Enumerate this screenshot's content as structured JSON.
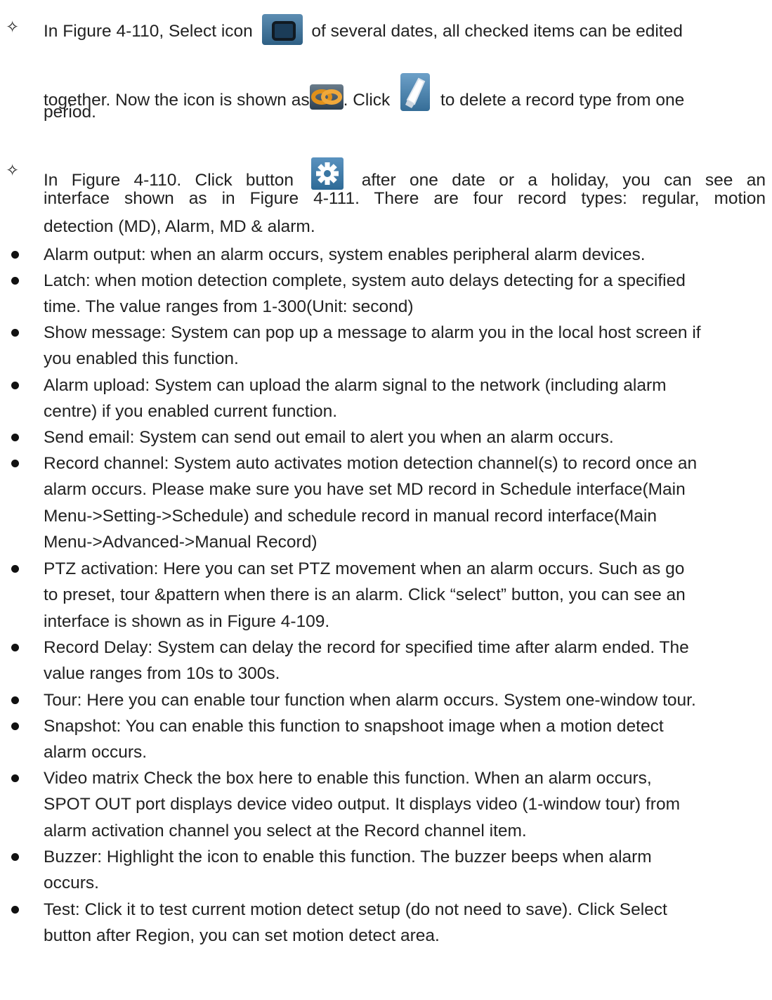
{
  "block1": {
    "line1_a": "In Figure 4-110, Select icon",
    "line1_b": "of several dates, all checked items can be edited",
    "line2_a": "together. Now the icon is shown as",
    "line2_b": ". Click",
    "line2_c": "to delete a record type from one",
    "line3": "period."
  },
  "block2": {
    "line1_a": "In Figure 4-110. Click button",
    "line1_b": "after one date or a holiday, you can see an",
    "line2": "interface shown as in Figure 4-111. There are four record types: regular, motion",
    "line3": "detection (MD), Alarm, MD & alarm."
  },
  "bullets": [
    {
      "lines": [
        "Alarm output: when an alarm occurs, system enables peripheral alarm devices."
      ]
    },
    {
      "lines": [
        "Latch: when motion detection complete, system auto delays detecting for a specified",
        "time. The value ranges from 1-300(Unit: second)"
      ]
    },
    {
      "lines": [
        "Show message: System can pop up a message to alarm you in the local host screen if",
        "you enabled this function."
      ]
    },
    {
      "lines": [
        "Alarm upload: System can upload the alarm signal to the network (including alarm",
        "centre) if you enabled current function."
      ]
    },
    {
      "lines": [
        "Send email: System can send out email to alert you when an alarm occurs."
      ]
    },
    {
      "lines": [
        "Record channel: System auto activates motion detection channel(s) to record once an",
        "alarm occurs. Please make sure you have set MD record in Schedule interface(Main",
        "Menu->Setting->Schedule) and schedule record in manual record interface(Main",
        "Menu->Advanced->Manual Record)"
      ]
    },
    {
      "lines": [
        "PTZ activation: Here you can set PTZ movement when an alarm occurs. Such as go",
        "to preset, tour &pattern when there is an alarm. Click “select” button, you can see an",
        "interface is shown as in Figure 4-109."
      ]
    },
    {
      "lines": [
        "Record Delay: System can delay the record for specified time after alarm ended. The",
        "value ranges from 10s to 300s."
      ]
    },
    {
      "lines": [
        "Tour: Here you can enable tour function when alarm occurs. System one-window tour."
      ]
    },
    {
      "lines": [
        "Snapshot: You can enable this function to snapshoot image when a motion detect",
        "alarm occurs."
      ]
    },
    {
      "lines": [
        "Video matrix Check the box here to enable this function. When an alarm occurs,",
        "SPOT OUT port displays device video output. It displays video (1-window tour) from",
        "alarm activation channel you select at the Record channel item."
      ]
    },
    {
      "lines": [
        "Buzzer: Highlight the icon to enable this function. The buzzer beeps when alarm",
        "occurs."
      ]
    },
    {
      "lines": [
        "Test: Click it to test current motion detect setup (do not need to save). Click Select",
        "button after Region, you can set motion detect area."
      ]
    }
  ]
}
